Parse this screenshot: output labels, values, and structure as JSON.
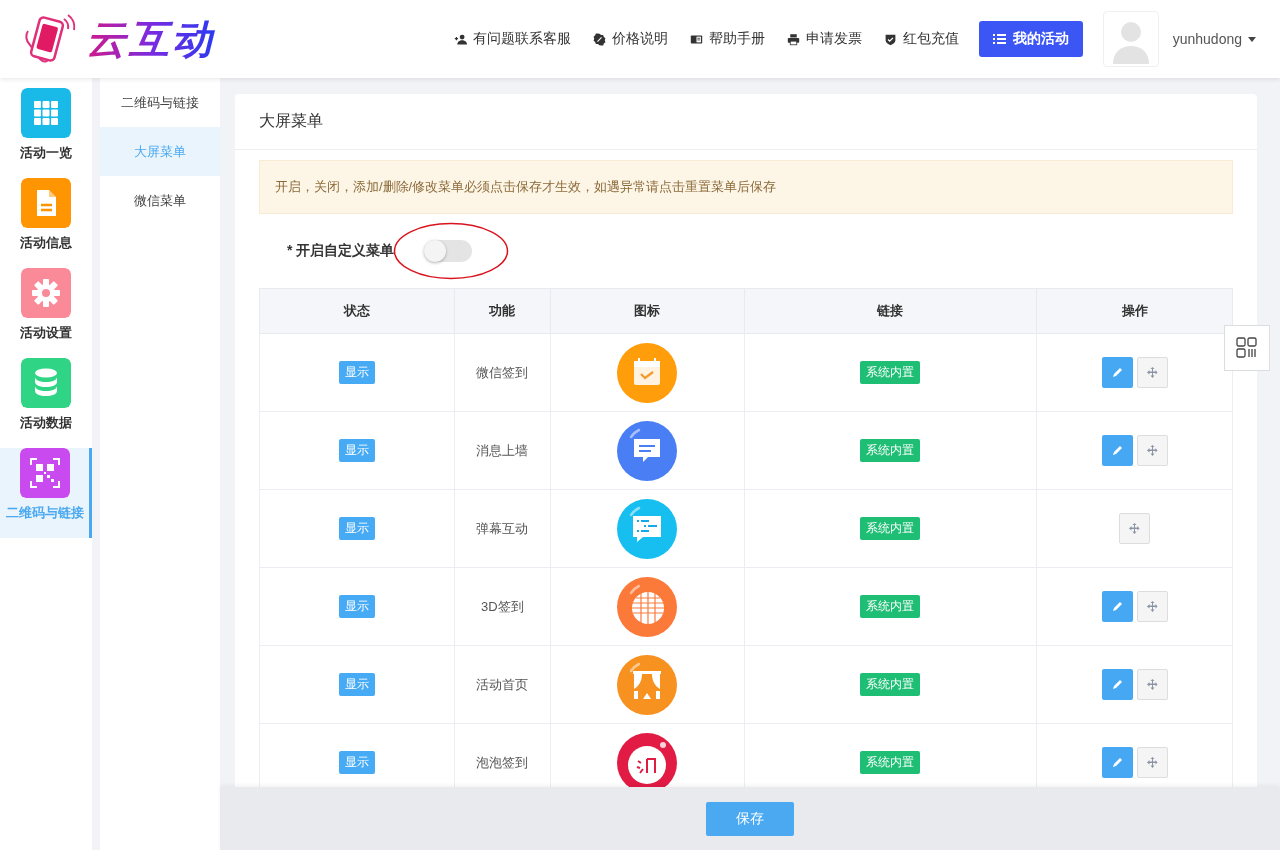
{
  "logo": {
    "text": "云互动"
  },
  "nav": [
    {
      "label": "有问题联系客服",
      "kind": "user-plus"
    },
    {
      "label": "价格说明",
      "kind": "badge"
    },
    {
      "label": "帮助手册",
      "kind": "book"
    },
    {
      "label": "申请发票",
      "kind": "printer"
    },
    {
      "label": "红包充值",
      "kind": "shield"
    }
  ],
  "primary_button": {
    "label": "我的活动"
  },
  "user": {
    "name": "yunhudong"
  },
  "sidebar": [
    {
      "label": "活动一览",
      "kind": "grid",
      "color": "#19b9e8",
      "selected": false
    },
    {
      "label": "活动信息",
      "kind": "document",
      "color": "#ff9500",
      "selected": false
    },
    {
      "label": "活动设置",
      "kind": "gear",
      "color": "#fb8a98",
      "selected": false
    },
    {
      "label": "活动数据",
      "kind": "database",
      "color": "#2fd584",
      "selected": false
    },
    {
      "label": "二维码与链接",
      "kind": "qr",
      "color": "#c94bf0",
      "selected": true
    }
  ],
  "subnav": [
    {
      "label": "二维码与链接",
      "selected": false
    },
    {
      "label": "大屏菜单",
      "selected": true
    },
    {
      "label": "微信菜单",
      "selected": false
    }
  ],
  "panel": {
    "title": "大屏菜单",
    "notice": "开启，关闭，添加/删除/修改菜单必须点击保存才生效，如遇异常请点击重置菜单后保存",
    "toggle": {
      "label": "* 开启自定义菜单",
      "on": false,
      "highlighted": true
    },
    "table": {
      "columns": [
        "状态",
        "功能",
        "图标",
        "链接",
        "操作"
      ],
      "rows": [
        {
          "status": "显示",
          "function": "微信签到",
          "kind": "calendar",
          "link": "系统内置",
          "editable": true
        },
        {
          "status": "显示",
          "function": "消息上墙",
          "kind": "chat",
          "link": "系统内置",
          "editable": true
        },
        {
          "status": "显示",
          "function": "弹幕互动",
          "kind": "list-chat",
          "link": "系统内置",
          "editable": false
        },
        {
          "status": "显示",
          "function": "3D签到",
          "kind": "globe",
          "link": "系统内置",
          "editable": true
        },
        {
          "status": "显示",
          "function": "活动首页",
          "kind": "curtain",
          "link": "系统内置",
          "editable": true
        },
        {
          "status": "显示",
          "function": "泡泡签到",
          "kind": "bubble",
          "link": "系统内置",
          "editable": true
        }
      ]
    }
  },
  "save_button": {
    "label": "保存"
  }
}
